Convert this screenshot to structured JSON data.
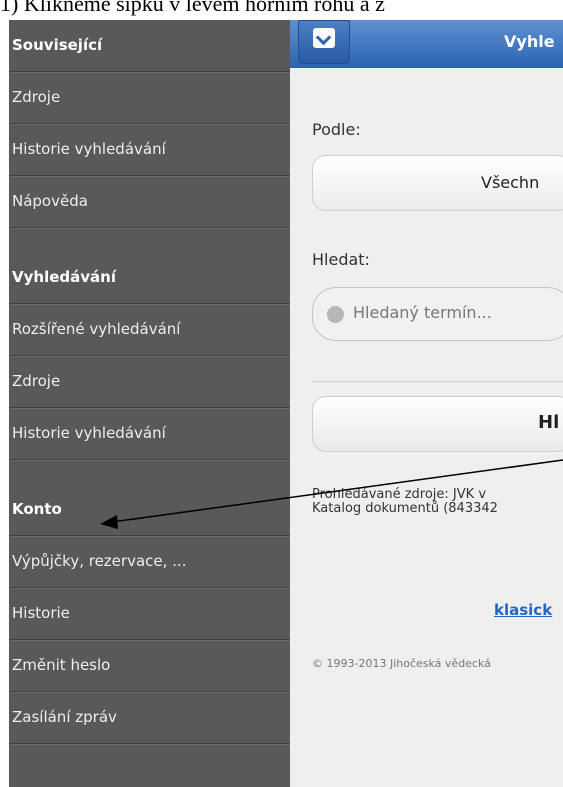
{
  "caption": "1) Klikněme šipku v levém horním rohu a z",
  "sidebar": {
    "related": {
      "heading": "Související",
      "items": [
        {
          "label": "Zdroje"
        },
        {
          "label": "Historie vyhledávání"
        },
        {
          "label": "Nápověda"
        }
      ]
    },
    "search": {
      "heading": "Vyhledávání",
      "items": [
        {
          "label": "Rozšířené vyhledávání"
        },
        {
          "label": "Zdroje"
        },
        {
          "label": "Historie vyhledávání"
        }
      ]
    },
    "account": {
      "heading": "Konto",
      "items": [
        {
          "label": "Výpůjčky, rezervace, ..."
        },
        {
          "label": "Historie"
        },
        {
          "label": "Změnit heslo"
        },
        {
          "label": "Zasílání zpráv"
        }
      ]
    }
  },
  "topbar": {
    "title": "Vyhle"
  },
  "form": {
    "by_label": "Podle:",
    "by_value": "Všechn",
    "search_label": "Hledat:",
    "search_placeholder": "Hledaný termín...",
    "search_button": "Hl",
    "sources_line1": "Prohledávané zdroje: JVK v",
    "sources_line2": "Katalog dokumentů (843342",
    "classic_link": "klasick",
    "copyright": "© 1993-2013 Jihočeská vědecká"
  },
  "colors": {
    "sidebar_bg": "#595959",
    "topbar": "#2c64b2",
    "link": "#2466c0"
  }
}
